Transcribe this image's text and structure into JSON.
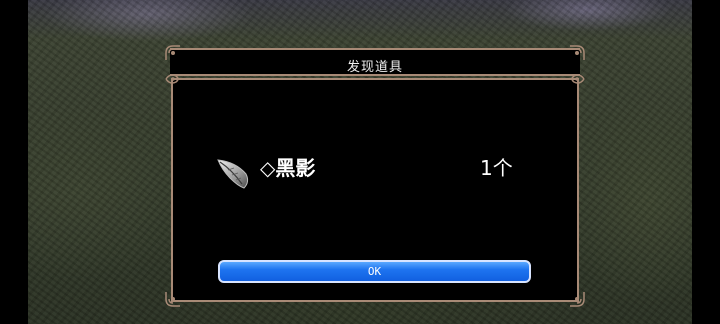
{
  "dialog": {
    "title": "发现道具",
    "ok_label": "OK"
  },
  "item": {
    "icon": "feather-quill-icon",
    "name": "◇黑影",
    "count": "1个"
  },
  "colors": {
    "frame": "#a88a76",
    "ok_button": "#1e74f0",
    "dialog_bg": "#000000",
    "text": "#ffffff"
  }
}
